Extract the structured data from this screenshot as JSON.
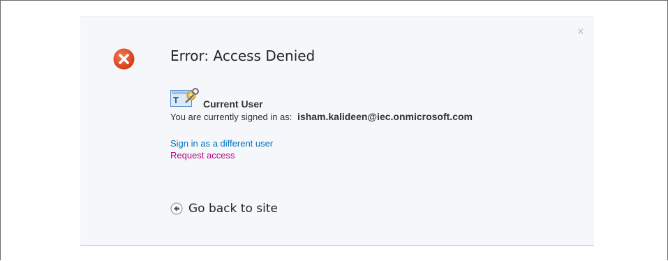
{
  "dialog": {
    "title": "Error: Access Denied",
    "close_label": "×"
  },
  "current_user": {
    "heading": "Current User",
    "signed_in_prefix": "You are currently signed in as:",
    "email": "isham.kalideen@iec.onmicrosoft.com"
  },
  "links": {
    "sign_in_different": "Sign in as a different user",
    "request_access": "Request access"
  },
  "back": {
    "label": "Go back to site"
  },
  "icons": {
    "error": "error-x-icon",
    "user": "user-tools-icon",
    "back": "back-arrow-icon"
  },
  "colors": {
    "error_red": "#e0401c",
    "link_blue": "#0072bc",
    "link_magenta": "#b5057b",
    "panel_bg": "#f5f7fa"
  }
}
